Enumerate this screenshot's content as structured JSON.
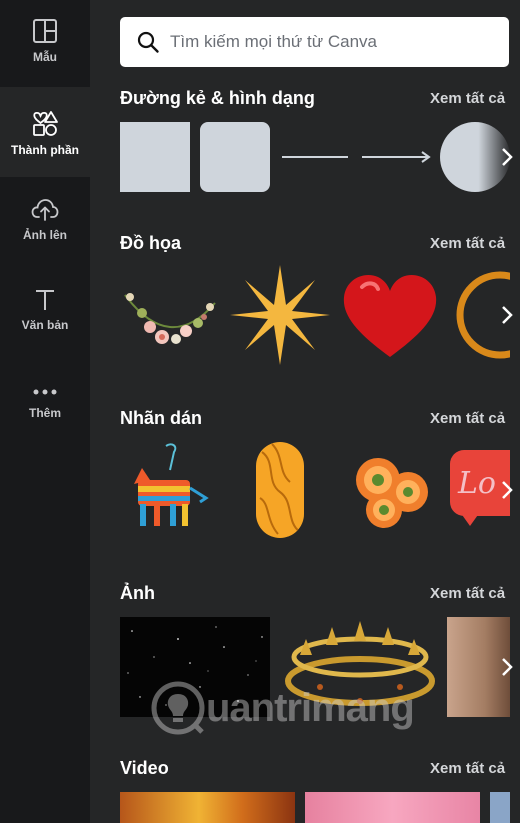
{
  "sidebar": {
    "items": [
      {
        "label": "Mẫu",
        "icon": "layout-icon",
        "active": false
      },
      {
        "label": "Thành phần",
        "icon": "elements-icon",
        "active": true
      },
      {
        "label": "Ảnh lên",
        "icon": "cloud-upload-icon",
        "active": false
      },
      {
        "label": "Văn bản",
        "icon": "text-icon",
        "active": false
      },
      {
        "label": "Thêm",
        "icon": "more-icon",
        "active": false
      }
    ]
  },
  "search": {
    "placeholder": "Tìm kiếm mọi thứ từ Canva"
  },
  "sections": {
    "lines_shapes": {
      "title": "Đường kẻ & hình dạng",
      "see_all": "Xem tất cả"
    },
    "graphics": {
      "title": "Đồ họa",
      "see_all": "Xem tất cả"
    },
    "stickers": {
      "title": "Nhãn dán",
      "see_all": "Xem tất cả"
    },
    "photos": {
      "title": "Ảnh",
      "see_all": "Xem tất cả"
    },
    "videos": {
      "title": "Video",
      "see_all": "Xem tất cả"
    }
  },
  "sticker_text": "Lo",
  "watermark": "uantrimang",
  "colors": {
    "sidebar_bg": "#18191b",
    "panel_bg": "#252627",
    "shape_fill": "#cfd5dc",
    "star": "#f4b73f",
    "heart": "#d4161b"
  }
}
